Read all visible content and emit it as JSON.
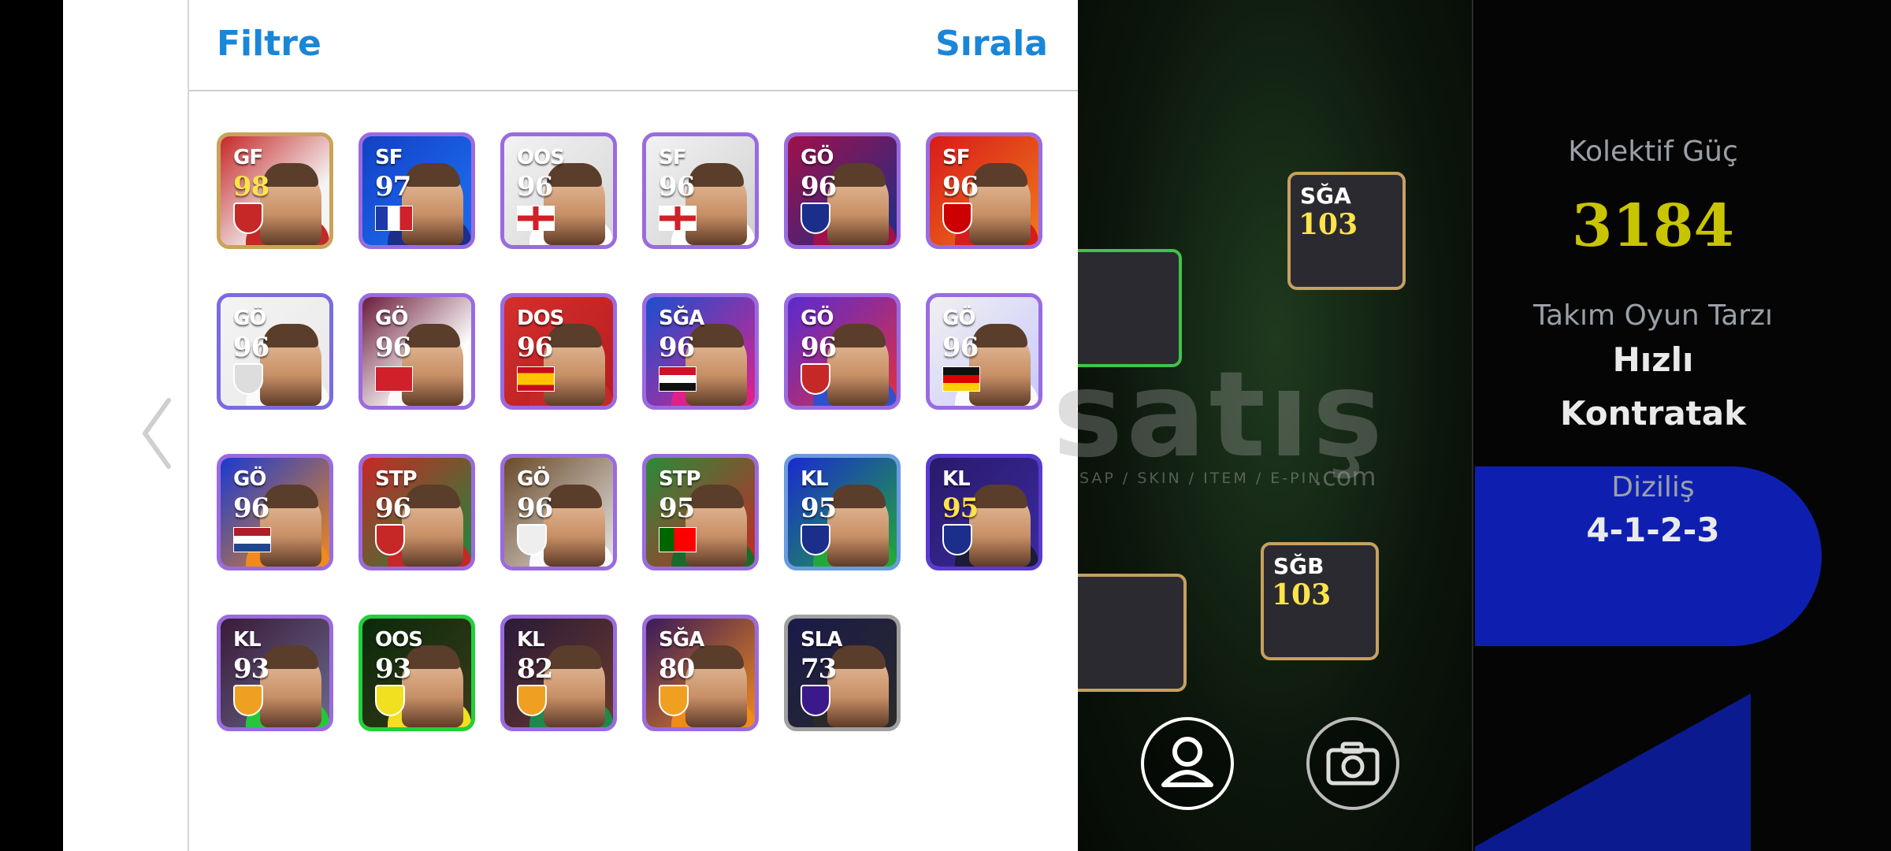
{
  "header": {
    "filter_label": "Filtre",
    "sort_label": "Sırala"
  },
  "cards": [
    {
      "pos": "GF",
      "rating": "98",
      "gold": true
    },
    {
      "pos": "SF",
      "rating": "97"
    },
    {
      "pos": "OOS",
      "rating": "96"
    },
    {
      "pos": "SF",
      "rating": "96"
    },
    {
      "pos": "GÖ",
      "rating": "96"
    },
    {
      "pos": "SF",
      "rating": "96"
    },
    {
      "pos": "GÖ",
      "rating": "96"
    },
    {
      "pos": "GÖ",
      "rating": "96"
    },
    {
      "pos": "DOS",
      "rating": "96"
    },
    {
      "pos": "SĞA",
      "rating": "96"
    },
    {
      "pos": "GÖ",
      "rating": "96"
    },
    {
      "pos": "GÖ",
      "rating": "96"
    },
    {
      "pos": "GÖ",
      "rating": "96"
    },
    {
      "pos": "STP",
      "rating": "96"
    },
    {
      "pos": "GÖ",
      "rating": "96"
    },
    {
      "pos": "STP",
      "rating": "95"
    },
    {
      "pos": "KL",
      "rating": "95"
    },
    {
      "pos": "KL",
      "rating": "95",
      "gold": true
    },
    {
      "pos": "KL",
      "rating": "93"
    },
    {
      "pos": "OOS",
      "rating": "93"
    },
    {
      "pos": "KL",
      "rating": "82"
    },
    {
      "pos": "SĞA",
      "rating": "80"
    },
    {
      "pos": "SLA",
      "rating": "73"
    }
  ],
  "pitch": {
    "watermark": "satış",
    "watermark_sub": "SAP / SKIN / ITEM / E-PIN",
    "watermark_com": ".com",
    "players": [
      {
        "pos": "SĞA",
        "rating": "103"
      },
      {
        "pos": "SĞB",
        "rating": "103"
      }
    ]
  },
  "stats": {
    "power_label": "Kolektif Güç",
    "power_value": "3184",
    "style_label": "Takım Oyun Tarzı",
    "style_value_1": "Hızlı",
    "style_value_2": "Kontratak",
    "formation_label": "Diziliş",
    "formation_value": "4-1-2-3"
  },
  "colors": {
    "accent": "#1a86d8",
    "power": "#c9c400"
  }
}
